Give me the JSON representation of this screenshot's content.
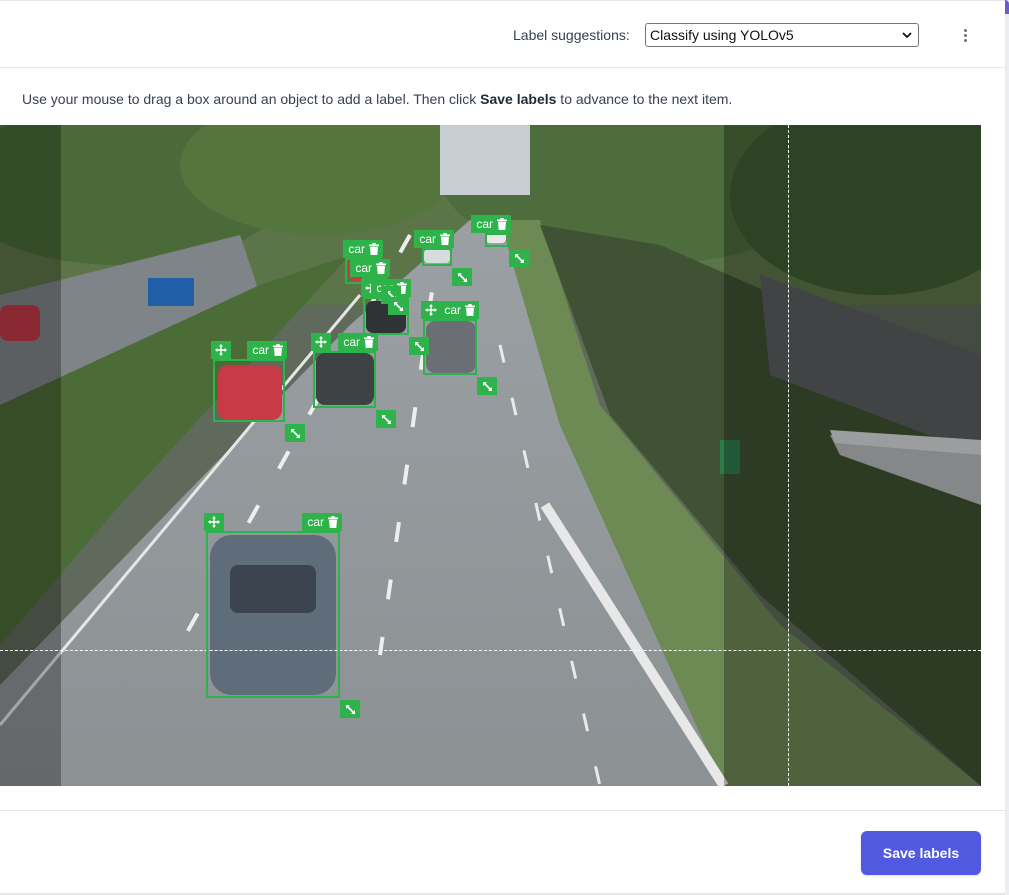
{
  "header": {
    "suggestions_label": "Label suggestions:",
    "suggestions_value": "Classify using YOLOv5",
    "menu_icon": "more-vertical-icon"
  },
  "instructions": {
    "prefix": "Use your mouse to drag a box around an object to add a label. Then click ",
    "emphasis": "Save labels",
    "suffix": " to advance to the next item."
  },
  "annotations": [
    {
      "label": "car"
    },
    {
      "label": "car"
    },
    {
      "label": "car"
    },
    {
      "label": "car"
    },
    {
      "label": "car"
    },
    {
      "label": "car"
    },
    {
      "label": "car"
    },
    {
      "label": "car"
    },
    {
      "label": "car"
    }
  ],
  "icons": {
    "move": "move-icon",
    "delete": "trash-icon",
    "resize": "resize-icon"
  },
  "colors": {
    "annotation": "#2db34a",
    "primary_button": "#5159e0"
  },
  "footer": {
    "save_label": "Save labels"
  }
}
